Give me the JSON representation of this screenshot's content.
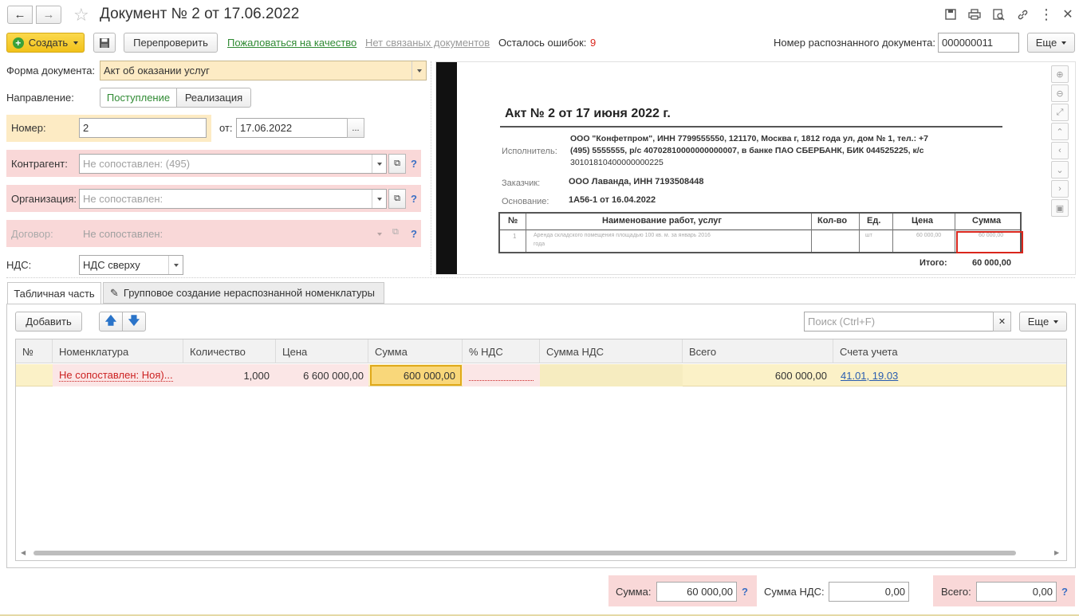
{
  "title": "Документ № 2 от 17.06.2022",
  "toolbar": {
    "create_label": "Создать",
    "recheck_label": "Перепроверить",
    "complain_label": "Пожаловаться на качество",
    "no_links_label": "Нет связаных документов",
    "errors_label": "Осталось ошибок:",
    "errors_count": "9",
    "recognized_label": "Номер распознанного документа:",
    "recognized_value": "000000011",
    "more_label": "Еще"
  },
  "form": {
    "doc_form_label": "Форма документа:",
    "doc_form_value": "Акт об оказании услуг",
    "direction_label": "Направление:",
    "direction_in": "Поступление",
    "direction_out": "Реализация",
    "number_label": "Номер:",
    "number_value": "2",
    "date_label": "от:",
    "date_value": "17.06.2022",
    "date_btn": "...",
    "counterparty_label": "Контрагент:",
    "counterparty_placeholder": "Не сопоставлен: (495)",
    "org_label": "Организация:",
    "org_placeholder": "Не сопоставлен:",
    "contract_label": "Договор:",
    "contract_placeholder": "Не сопоставлен:",
    "vat_label": "НДС:",
    "vat_value": "НДС сверху",
    "help": "?"
  },
  "scan": {
    "title": "Акт № 2 от 17 июня 2022 г.",
    "executor_label": "Исполнитель:",
    "executor_line1": "ООО \"Конфетпром\", ИНН 7799555550, 121170, Москва г, 1812 года ул, дом № 1, тел.: +7",
    "executor_line2": "(495) 5555555, р/с 40702810000000000007, в банке ПАО СБЕРБАНК, БИК 044525225, к/с",
    "executor_line3": "30101810400000000225",
    "customer_label": "Заказчик:",
    "customer_value": "ООО Лаванда, ИНН 7193508448",
    "basis_label": "Основание:",
    "basis_value": "1А56-1 от 16.04.2022",
    "columns": [
      "№",
      "Наименование работ, услуг",
      "Кол-во",
      "Ед.",
      "Цена",
      "Сумма"
    ],
    "row_num": "1",
    "row_name_1": "Аренда складского помещения площадью 100 кв. м. за январь 2016",
    "row_name_2": "года",
    "row_unit": "шт",
    "row_price": "60 000,00",
    "row_sum": "60 000,00",
    "total_label": "Итого:",
    "total_value": "60 000,00"
  },
  "tabs": {
    "table_tab": "Табличная часть",
    "group_tab": "Групповое создание нераспознанной номенклатуры"
  },
  "table_toolbar": {
    "add_label": "Добавить",
    "search_placeholder": "Поиск (Ctrl+F)",
    "more_label": "Еще"
  },
  "table": {
    "headers": [
      "№",
      "Номенклатура",
      "Количество",
      "Цена",
      "Сумма",
      "% НДС",
      "Сумма НДС",
      "Всего",
      "Счета учета"
    ],
    "row": {
      "num": "",
      "nomenclature": "Не сопоставлен: Ноя)...",
      "qty": "1,000",
      "price": "6 600 000,00",
      "sum": "600 000,00",
      "vat_pct": "",
      "vat_sum": "",
      "total": "600 000,00",
      "accounts": "41.01, 19.03"
    }
  },
  "footer": {
    "sum_label": "Сумма:",
    "sum_value": "60 000,00",
    "vat_label": "Сумма НДС:",
    "vat_value": "0,00",
    "total_label": "Всего:",
    "total_value": "0,00",
    "help": "?"
  },
  "colors": {
    "accent_green": "#2f8a33",
    "create_yellow": "#f6c92a",
    "error_red": "#d9261c",
    "pink_bg": "#f9d8d8",
    "yellow_bg": "#fdebc4"
  }
}
